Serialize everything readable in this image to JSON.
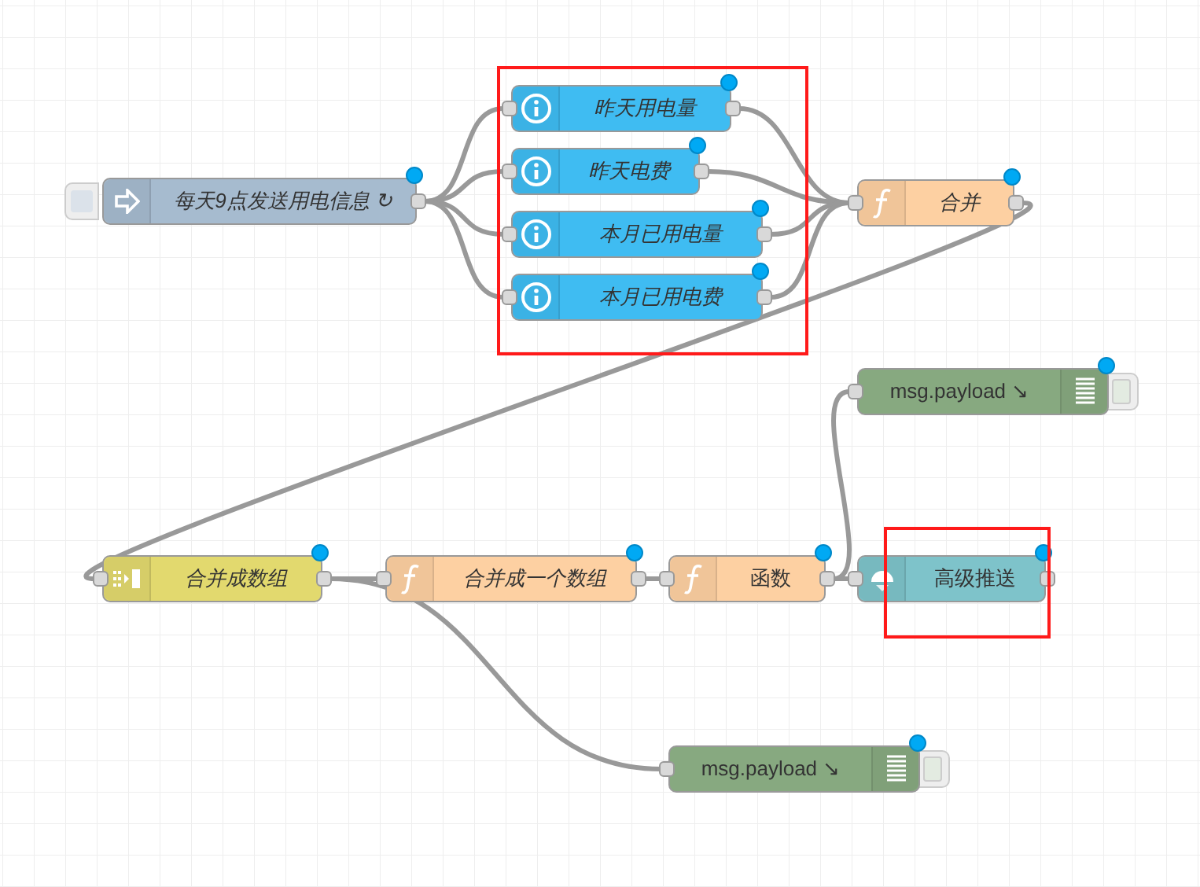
{
  "nodes": [
    {
      "kind": "inject",
      "label": "每天9点发送用电信息 ↻",
      "italic": true,
      "changed": true
    },
    {
      "kind": "api",
      "label": "昨天用电量",
      "italic": true,
      "changed": true
    },
    {
      "kind": "api",
      "label": "昨天电费",
      "italic": true,
      "changed": true
    },
    {
      "kind": "api",
      "label": "本月已用电量",
      "italic": true,
      "changed": true
    },
    {
      "kind": "api",
      "label": "本月已用电费",
      "italic": true,
      "changed": true
    },
    {
      "kind": "function",
      "label": "合并",
      "italic": true,
      "changed": true
    },
    {
      "kind": "debug",
      "label": "msg.payload ↘",
      "italic": false,
      "changed": true
    },
    {
      "kind": "join",
      "label": "合并成数组",
      "italic": true,
      "changed": true
    },
    {
      "kind": "function",
      "label": "合并成一个数组",
      "italic": true,
      "changed": true
    },
    {
      "kind": "function",
      "label": "函数",
      "italic": false,
      "changed": true
    },
    {
      "kind": "pushover",
      "label": "高级推送",
      "italic": false,
      "changed": true
    },
    {
      "kind": "debug",
      "label": "msg.payload ↘",
      "italic": false,
      "changed": true
    }
  ]
}
